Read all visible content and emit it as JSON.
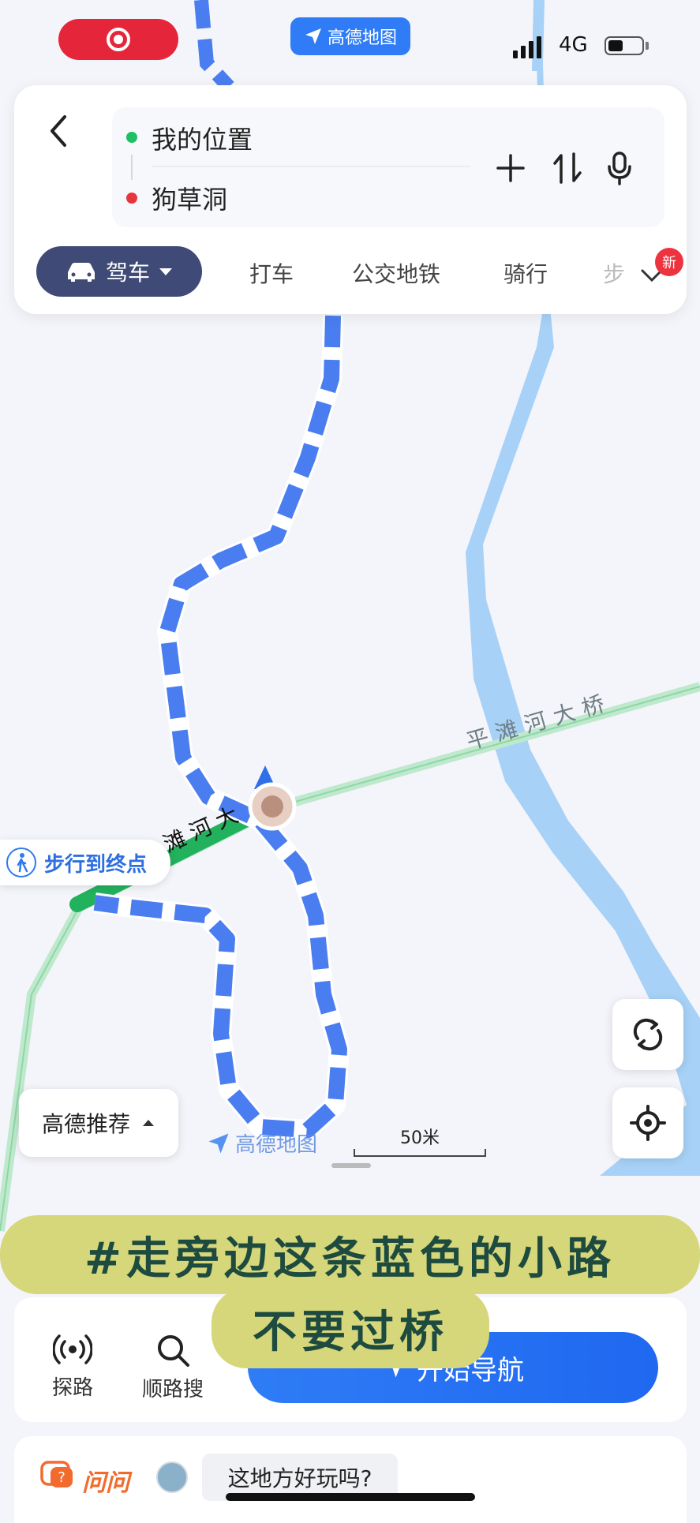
{
  "status_bar": {
    "network": "4G",
    "app_name": "高德地图"
  },
  "route": {
    "origin": "我的位置",
    "destination": "狗草洞"
  },
  "modes": {
    "active": "驾车",
    "items": [
      "打车",
      "公交地铁",
      "骑行",
      "步"
    ],
    "new_badge": "新"
  },
  "map": {
    "road_label_bridge": "平滩河大桥",
    "road_label_partial": "滩河大",
    "walk_to_end": "步行到终点",
    "recommend": "高德推荐",
    "scale": "50米",
    "watermark": "高德地图"
  },
  "bottom": {
    "explore": "探路",
    "along_search": "顺路搜",
    "navigate": "开始导航"
  },
  "ask": {
    "label": "问问",
    "question": "这地方好玩吗?"
  },
  "caption": {
    "line1": "#走旁边这条蓝色的小路",
    "line2": "不要过桥"
  },
  "colors": {
    "route_blue": "#4a7ef0",
    "river": "#a7d1f6",
    "road_green": "#9fdcb5",
    "accent": "#2f7cf6"
  }
}
